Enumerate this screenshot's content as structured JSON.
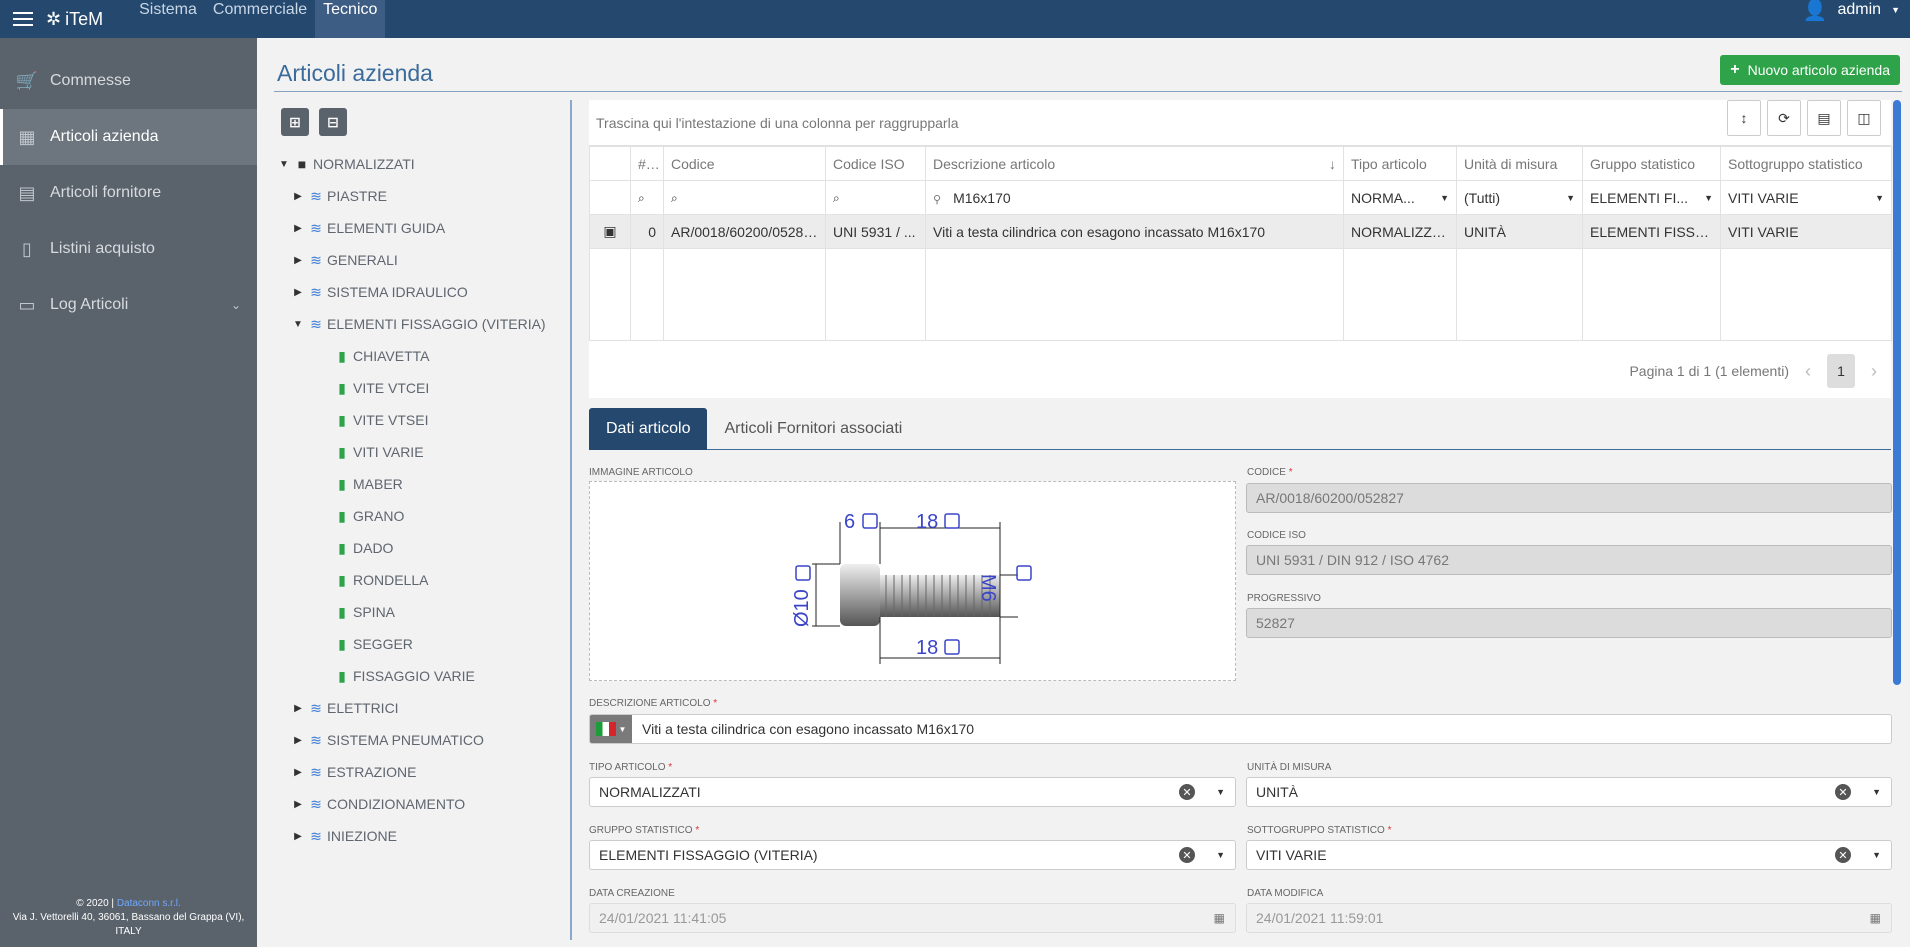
{
  "topbar": {
    "brand": "iTeM",
    "nav": [
      "Sistema",
      "Commerciale",
      "Tecnico"
    ],
    "active_nav": "Tecnico",
    "user": "admin"
  },
  "sidebar": {
    "items": [
      {
        "label": "Commesse",
        "icon": "cart-icon"
      },
      {
        "label": "Articoli azienda",
        "icon": "building-icon"
      },
      {
        "label": "Articoli fornitore",
        "icon": "warehouse-icon"
      },
      {
        "label": "Listini acquisto",
        "icon": "price-list-icon"
      },
      {
        "label": "Log Articoli",
        "icon": "clipboard-icon"
      }
    ],
    "footer_line1_prefix": "© 2020 |",
    "footer_link": "Dataconn s.r.l.",
    "footer_line2": "Via J. Vettorelli 40, 36061, Bassano del Grappa (VI),",
    "footer_line3": "ITALY"
  },
  "page": {
    "title": "Articoli azienda",
    "new_button": "Nuovo articolo azienda"
  },
  "tree": {
    "root": "NORMALIZZATI",
    "nodes": [
      {
        "label": "PIASTRE",
        "level": 1,
        "type": "layer",
        "arrow": "right"
      },
      {
        "label": "ELEMENTI GUIDA",
        "level": 1,
        "type": "layer",
        "arrow": "right"
      },
      {
        "label": "GENERALI",
        "level": 1,
        "type": "layer",
        "arrow": "right"
      },
      {
        "label": "SISTEMA IDRAULICO",
        "level": 1,
        "type": "layer",
        "arrow": "right"
      },
      {
        "label": "ELEMENTI FISSAGGIO (VITERIA)",
        "level": 1,
        "type": "layer",
        "arrow": "down"
      },
      {
        "label": "CHIAVETTA",
        "level": 2,
        "type": "file",
        "arrow": ""
      },
      {
        "label": "VITE VTCEI",
        "level": 2,
        "type": "file",
        "arrow": ""
      },
      {
        "label": "VITE VTSEI",
        "level": 2,
        "type": "file",
        "arrow": ""
      },
      {
        "label": "VITI VARIE",
        "level": 2,
        "type": "file",
        "arrow": ""
      },
      {
        "label": "MABER",
        "level": 2,
        "type": "file",
        "arrow": ""
      },
      {
        "label": "GRANO",
        "level": 2,
        "type": "file",
        "arrow": ""
      },
      {
        "label": "DADO",
        "level": 2,
        "type": "file",
        "arrow": ""
      },
      {
        "label": "RONDELLA",
        "level": 2,
        "type": "file",
        "arrow": ""
      },
      {
        "label": "SPINA",
        "level": 2,
        "type": "file",
        "arrow": ""
      },
      {
        "label": "SEGGER",
        "level": 2,
        "type": "file",
        "arrow": ""
      },
      {
        "label": "FISSAGGIO VARIE",
        "level": 2,
        "type": "file",
        "arrow": ""
      },
      {
        "label": "ELETTRICI",
        "level": 1,
        "type": "layer",
        "arrow": "right"
      },
      {
        "label": "SISTEMA PNEUMATICO",
        "level": 1,
        "type": "layer",
        "arrow": "right"
      },
      {
        "label": "ESTRAZIONE",
        "level": 1,
        "type": "layer",
        "arrow": "right"
      },
      {
        "label": "CONDIZIONAMENTO",
        "level": 1,
        "type": "layer",
        "arrow": "right"
      },
      {
        "label": "INIEZIONE",
        "level": 1,
        "type": "layer",
        "arrow": "right"
      }
    ]
  },
  "grid": {
    "group_hint": "Trascina qui l'intestazione di una colonna per raggrupparla",
    "columns": [
      "",
      "#...",
      "Codice",
      "Codice ISO",
      "Descrizione articolo",
      "Tipo articolo",
      "Unità di misura",
      "Gruppo statistico",
      "Sottogruppo statistico"
    ],
    "filters": {
      "descrizione": "M16x170",
      "tipo": "NORMA...",
      "unita": "(Tutti)",
      "gruppo": "ELEMENTI FI...",
      "sottogruppo": "VITI VARIE"
    },
    "row": {
      "num": "0",
      "codice": "AR/0018/60200/052827",
      "codice_iso": "UNI 5931 / ...",
      "descrizione": "Viti a testa cilindrica con esagono incassato M16x170",
      "tipo": "NORMALIZZATI",
      "unita": "UNITÀ",
      "gruppo": "ELEMENTI FISSAG...",
      "sottogruppo": "VITI VARIE"
    },
    "pager_text": "Pagina 1 di 1 (1 elementi)",
    "current_page": "1"
  },
  "tabs": [
    "Dati articolo",
    "Articoli Fornitori associati"
  ],
  "form": {
    "immagine_label": "IMMAGINE ARTICOLO",
    "drawing": {
      "dim_head": "6",
      "dim_thread": "18",
      "dim_bottom": "18",
      "dim_dia": "Ø10",
      "dim_thread_dia": "M6"
    },
    "codice_label": "CODICE",
    "codice": "AR/0018/60200/052827",
    "codice_iso_label": "CODICE ISO",
    "codice_iso": "UNI 5931 / DIN 912 / ISO 4762",
    "progressivo_label": "PROGRESSIVO",
    "progressivo": "52827",
    "descrizione_label": "DESCRIZIONE ARTICOLO",
    "descrizione": "Viti a testa cilindrica con esagono incassato M16x170",
    "tipo_label": "TIPO ARTICOLO",
    "tipo": "NORMALIZZATI",
    "unita_label": "UNITÀ DI MISURA",
    "unita": "UNITÀ",
    "gruppo_label": "GRUPPO STATISTICO",
    "gruppo": "ELEMENTI FISSAGGIO (VITERIA)",
    "sottogruppo_label": "SOTTOGRUPPO STATISTICO",
    "sottogruppo": "VITI VARIE",
    "data_creazione_label": "DATA CREAZIONE",
    "data_creazione": "24/01/2021 11:41:05",
    "data_modifica_label": "DATA MODIFICA",
    "data_modifica": "24/01/2021 11:59:01"
  }
}
